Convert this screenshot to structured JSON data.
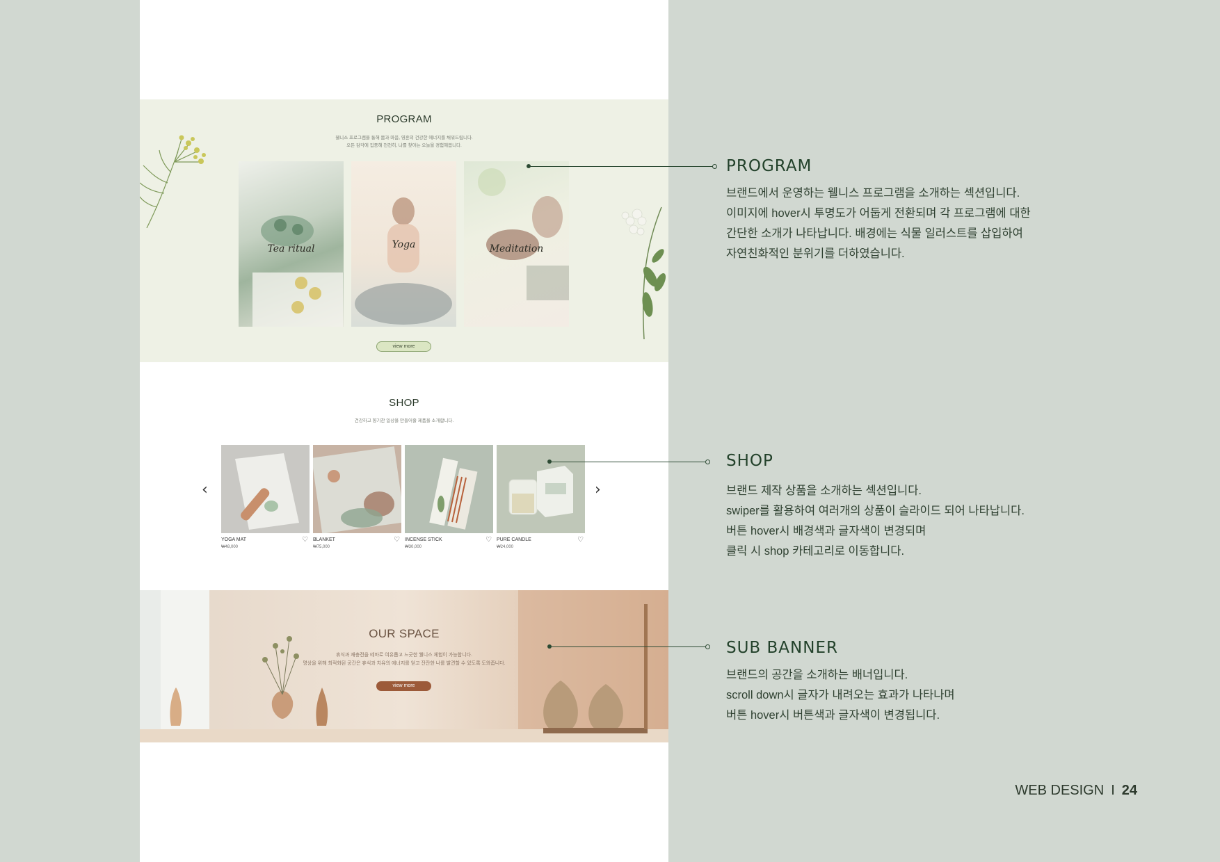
{
  "program": {
    "title": "PROGRAM",
    "desc_line1": "웰니스 프로그램을 통해 몸과 마음, 영혼의 건강한 에너지를 채워드립니다.",
    "desc_line2": "오든 감각에 집중해 천천히, 나를 찾아는 오늘을 경험해봅니다.",
    "cards": [
      "Tea ritual",
      "Yoga",
      "Meditation"
    ],
    "button": "view more"
  },
  "shop": {
    "title": "SHOP",
    "desc": "건강하고 향기찬 일상을 만들어줄 제품을 소개합니다.",
    "products": [
      {
        "name": "YOGA MAT",
        "price": "₩48,000"
      },
      {
        "name": "BLANKET",
        "price": "₩75,000"
      },
      {
        "name": "INCENSE STICK",
        "price": "₩30,000"
      },
      {
        "name": "PURE CANDLE",
        "price": "₩24,000"
      }
    ],
    "prev": "‹",
    "next": "›"
  },
  "banner": {
    "title": "OUR SPACE",
    "desc_line1": "휴식과 재충전을 테마로 여유롭고 느긋한 웰니스 체험이 가능합니다.",
    "desc_line2": "명상을 위해 최적화된 공간은 휴식과 치유의 에너지를 얻고 잔잔한 나를 발견할 수 있도록 도와줍니다.",
    "button": "view more"
  },
  "annotations": {
    "program": {
      "title": "PROGRAM",
      "lines": [
        "브랜드에서 운영하는 웰니스 프로그램을 소개하는 섹션입니다.",
        "이미지에 hover시 투명도가 어둡게 전환되며 각 프로그램에 대한",
        "간단한 소개가 나타납니다. 배경에는 식물 일러스트를 삽입하여",
        "자연친화적인 분위기를 더하였습니다."
      ]
    },
    "shop": {
      "title": "SHOP",
      "lines": [
        "브랜드 제작 상품을 소개하는 섹션입니다.",
        "swiper를 활용하여 여러개의 상품이 슬라이드 되어 나타납니다.",
        "버튼 hover시 배경색과 글자색이 변경되며",
        "클릭 시 shop 카테고리로 이동합니다."
      ]
    },
    "banner": {
      "title": "SUB BANNER",
      "lines": [
        "브랜드의 공간을 소개하는 배너입니다.",
        "scroll down시 글자가 내려오는 효과가 나타나며",
        "버튼 hover시 버튼색과 글자색이 변경됩니다."
      ]
    }
  },
  "footer": {
    "label": "WEB DESIGN",
    "separator": "I",
    "page": "24"
  }
}
